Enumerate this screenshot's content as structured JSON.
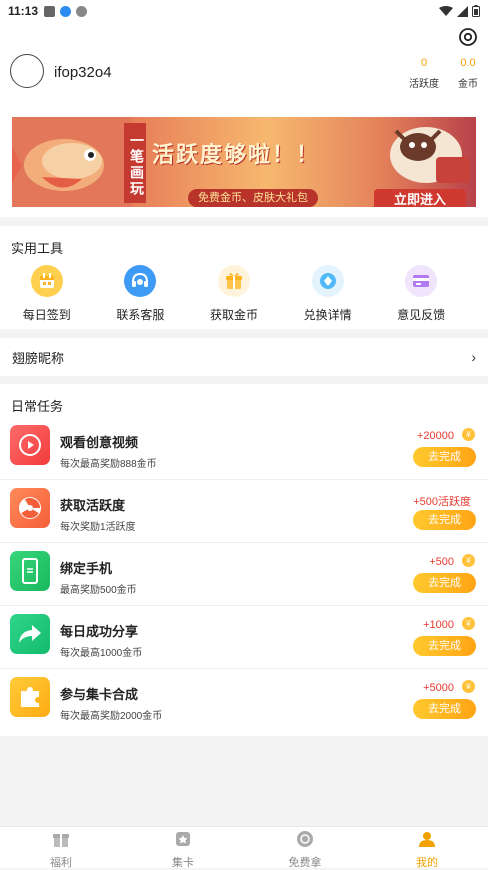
{
  "status_bar": {
    "time": "11:13"
  },
  "profile": {
    "username": "ifop32o4",
    "activity_value": "0",
    "activity_label": "活跃度",
    "gold_value": "0.0",
    "gold_label": "金币"
  },
  "banner": {
    "vertical_text": "一笔画玩",
    "headline": "活跃度够啦！！",
    "pill_text": "免费金币、皮肤大礼包",
    "cta": "立即进入"
  },
  "tools": {
    "title": "实用工具",
    "items": [
      {
        "label": "每日签到",
        "icon": "calendar-icon",
        "color": "#ffb31f"
      },
      {
        "label": "联系客服",
        "icon": "headset-icon",
        "color": "#3d9bf5"
      },
      {
        "label": "获取金币",
        "icon": "gift-icon",
        "color": "#ffc54a"
      },
      {
        "label": "兑换详情",
        "icon": "diamond-icon",
        "color": "#4fb9f8"
      },
      {
        "label": "意见反馈",
        "icon": "card-icon",
        "color": "#b07af3"
      }
    ]
  },
  "nickname_row": {
    "label": "翅膀昵称",
    "arrow": "›"
  },
  "tasks": {
    "title": "日常任务",
    "items": [
      {
        "title": "观看创意视频",
        "desc": "每次最高奖励888金币",
        "reward": "+20000",
        "button": "去完成",
        "icon": "play-icon",
        "color_from": "#ff6b6b",
        "color_to": "#f23b3b"
      },
      {
        "title": "获取活跃度",
        "desc": "每次奖励1活跃度",
        "reward": "+500活跃度",
        "button": "去完成",
        "icon": "radiation-icon",
        "color_from": "#ff8a5b",
        "color_to": "#f45f3a"
      },
      {
        "title": "绑定手机",
        "desc": "最高奖励500金币",
        "reward": "+500",
        "button": "去完成",
        "icon": "phone-icon",
        "color_from": "#37d67a",
        "color_to": "#18b85e"
      },
      {
        "title": "每日成功分享",
        "desc": "每次最高1000金币",
        "reward": "+1000",
        "button": "去完成",
        "icon": "share-icon",
        "color_from": "#2fd58a",
        "color_to": "#14bb6c"
      },
      {
        "title": "参与集卡合成",
        "desc": "每次最高奖励2000金币",
        "reward": "+5000",
        "button": "去完成",
        "icon": "puzzle-icon",
        "color_from": "#ffcc3a",
        "color_to": "#ffab12"
      }
    ],
    "coin_symbol": "¥"
  },
  "tabbar": [
    {
      "label": "福利",
      "icon": "gift-tab-icon",
      "active": false
    },
    {
      "label": "集卡",
      "icon": "cards-tab-icon",
      "active": false
    },
    {
      "label": "免费拿",
      "icon": "free-tab-icon",
      "active": false
    },
    {
      "label": "我的",
      "icon": "profile-tab-icon",
      "active": true
    }
  ]
}
